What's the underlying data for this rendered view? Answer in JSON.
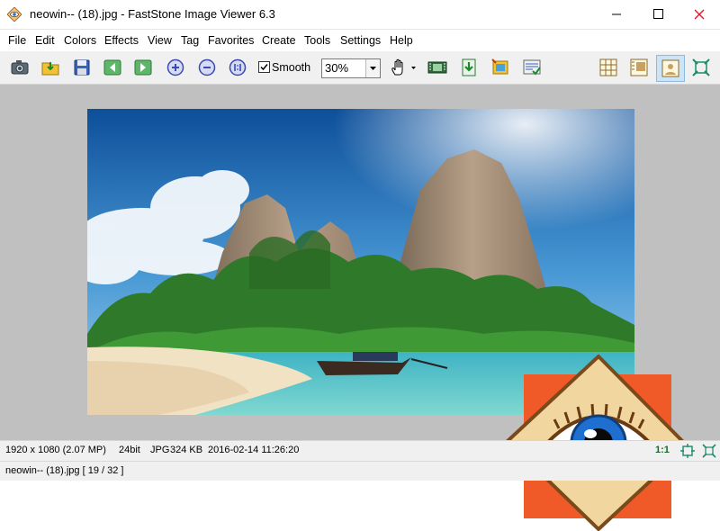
{
  "window": {
    "title": "neowin-- (18).jpg  -  FastStone Image Viewer 6.3",
    "controls": {
      "minimize": "minimize-icon",
      "maximize": "maximize-icon",
      "close": "close-icon"
    }
  },
  "menu": [
    {
      "label": "File"
    },
    {
      "label": "Edit"
    },
    {
      "label": "Colors"
    },
    {
      "label": "Effects"
    },
    {
      "label": "View"
    },
    {
      "label": "Tag"
    },
    {
      "label": "Favorites"
    },
    {
      "label": "Create"
    },
    {
      "label": "Tools"
    },
    {
      "label": "Settings"
    },
    {
      "label": "Help"
    }
  ],
  "toolbar": {
    "smooth_label": "Smooth",
    "smooth_checked": true,
    "zoom_value": "30%",
    "icons": [
      "camera-icon",
      "open-folder-icon",
      "save-icon",
      "previous-image-icon",
      "next-image-icon",
      "zoom-in-icon",
      "zoom-out-icon",
      "actual-size-icon",
      "hand-tool-icon",
      "slideshow-icon",
      "export-icon",
      "crop-icon",
      "batch-icon",
      "thumbnail-layout-icon",
      "browser-layout-icon",
      "viewer-layout-icon",
      "fullscreen-icon"
    ]
  },
  "status": {
    "resolution": "1920 x 1080 (2.07 MP)",
    "bit_depth": "24bit",
    "format": "JPG",
    "file_size": "324 KB",
    "date": "2016-02-14 11:26:20",
    "ratio": "1:1",
    "file_info": "neowin-- (18).jpg [ 19 / 32 ]"
  },
  "colors": {
    "viewer_bg": "#c0c0c0",
    "close_red": "#e81123",
    "logo_orange": "#f05a28",
    "logo_tan": "#f2d6a0",
    "eye_blue": "#1f6fd0"
  }
}
